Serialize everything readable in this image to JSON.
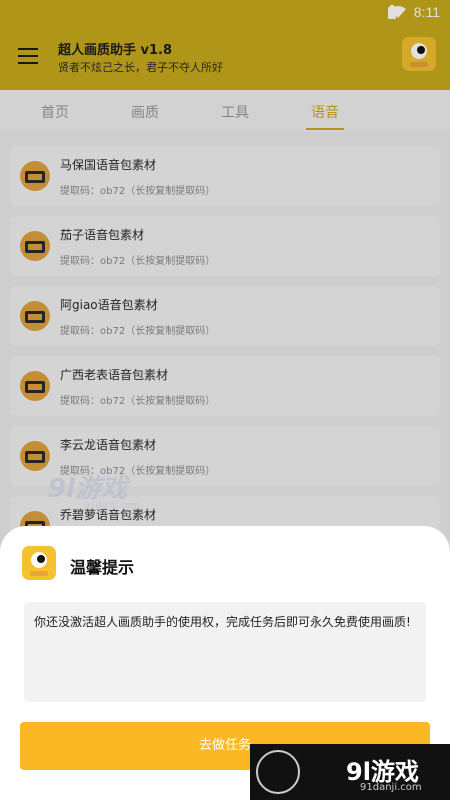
{
  "status_bar": {
    "time": "8:11"
  },
  "app_bar": {
    "title": "超人画质助手 v1.8",
    "subtitle": "贤者不炫己之长，君子不夺人所好"
  },
  "tabs": [
    {
      "label": "首页",
      "active": false
    },
    {
      "label": "画质",
      "active": false
    },
    {
      "label": "工具",
      "active": false
    },
    {
      "label": "语音",
      "active": true
    }
  ],
  "list": [
    {
      "name": "马保国语音包素材",
      "code": "提取码：ob72（长按复制提取码）"
    },
    {
      "name": "茄子语音包素材",
      "code": "提取码：ob72（长按复制提取码）"
    },
    {
      "name": "阿giao语音包素材",
      "code": "提取码：ob72（长按复制提取码）"
    },
    {
      "name": "广西老表语音包素材",
      "code": "提取码：ob72（长按复制提取码）"
    },
    {
      "name": "李云龙语音包素材",
      "code": "提取码：ob72（长按复制提取码）"
    },
    {
      "name": "乔碧萝语音包素材",
      "code": ""
    }
  ],
  "dialog": {
    "title": "温馨提示",
    "message": "你还没激活超人画质助手的使用权，完成任务后即可永久免费使用画质!",
    "button": "去做任务"
  },
  "watermark": {
    "primary": "9l游戏",
    "primary_url": "91danji.com",
    "corner_text": "9l游戏",
    "corner_url": "91danji.com"
  },
  "colors": {
    "accent": "#c9ab1c",
    "button": "#fbb824"
  }
}
